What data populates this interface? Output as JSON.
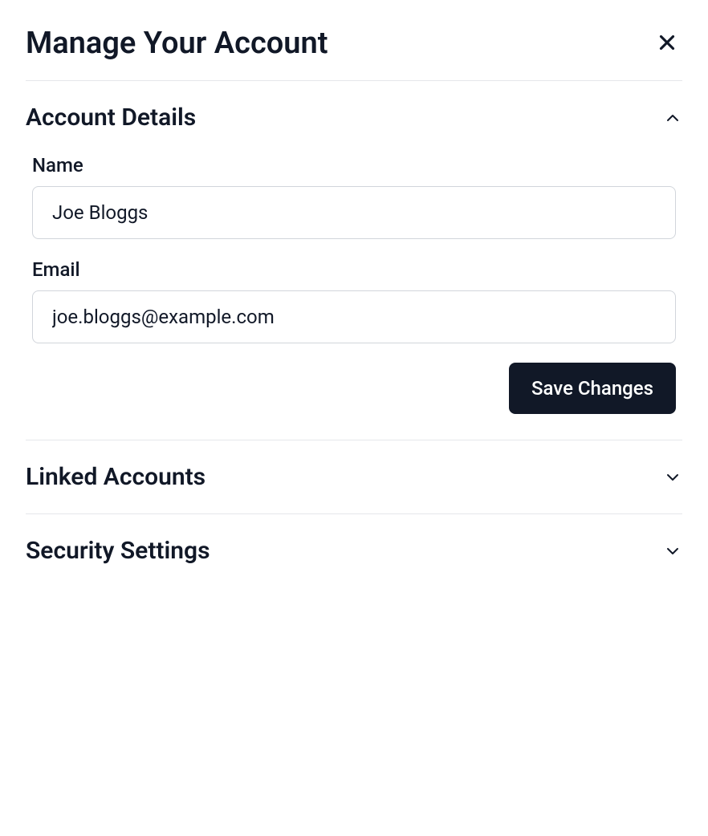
{
  "header": {
    "title": "Manage Your Account"
  },
  "sections": {
    "account_details": {
      "title": "Account Details",
      "name_label": "Name",
      "name_value": "Joe Bloggs",
      "email_label": "Email",
      "email_value": "joe.bloggs@example.com",
      "save_label": "Save Changes"
    },
    "linked_accounts": {
      "title": "Linked Accounts"
    },
    "security_settings": {
      "title": "Security Settings"
    }
  }
}
